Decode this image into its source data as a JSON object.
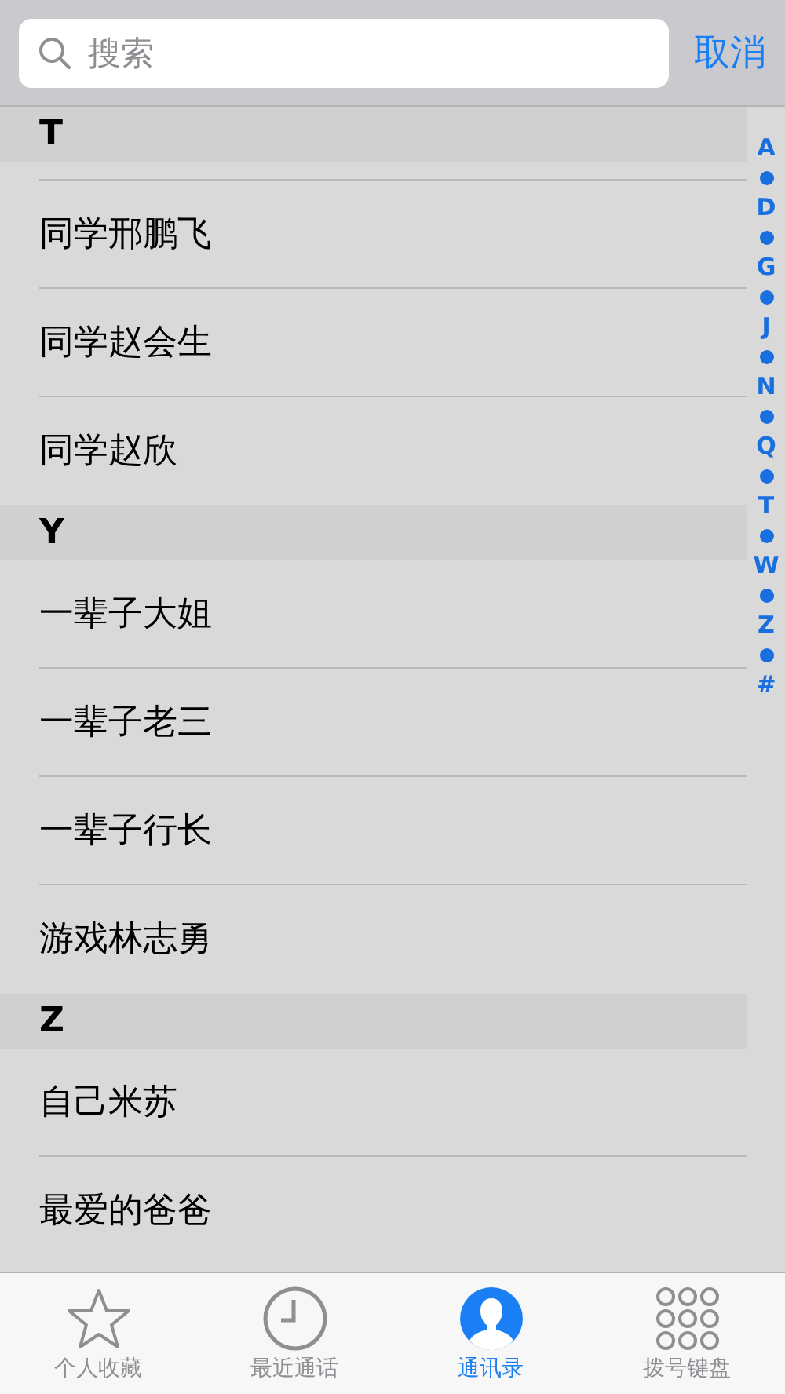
{
  "search": {
    "placeholder": "搜索"
  },
  "cancel_button": "取消",
  "sections": [
    {
      "letter": "T",
      "contacts": [
        "同学邢鹏飞",
        "同学赵会生",
        "同学赵欣"
      ]
    },
    {
      "letter": "Y",
      "contacts": [
        "一辈子大姐",
        "一辈子老三",
        "一辈子行长",
        "游戏林志勇"
      ]
    },
    {
      "letter": "Z",
      "contacts": [
        "自己米苏",
        "最爱的爸爸"
      ]
    }
  ],
  "index": [
    "A",
    "D",
    "G",
    "J",
    "N",
    "Q",
    "T",
    "W",
    "Z",
    "#"
  ],
  "tabs": [
    {
      "label": "个人收藏",
      "kind": "star",
      "selected": false
    },
    {
      "label": "最近通话",
      "kind": "clock",
      "selected": false
    },
    {
      "label": "通讯录",
      "kind": "contact",
      "selected": true
    },
    {
      "label": "拨号键盘",
      "kind": "keypad",
      "selected": false
    }
  ]
}
